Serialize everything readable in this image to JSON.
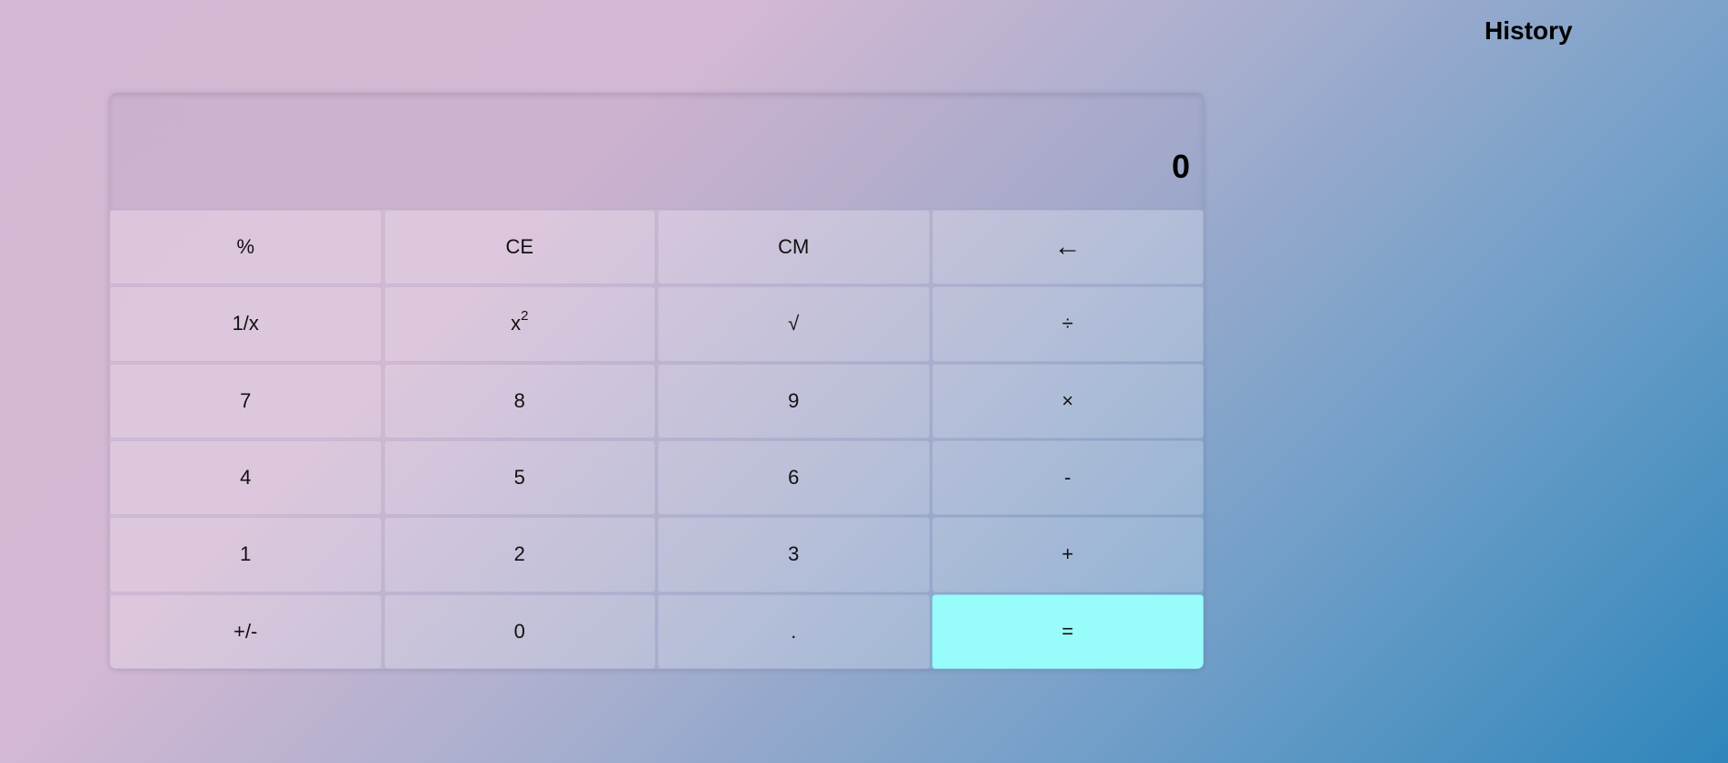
{
  "history": {
    "title": "History"
  },
  "display": {
    "value": "0"
  },
  "keys": {
    "percent": "%",
    "ce": "CE",
    "cm": "CM",
    "backspace": "←",
    "reciprocal": "1/x",
    "square_base": "x",
    "square_exp": "2",
    "sqrt": "√",
    "divide": "÷",
    "seven": "7",
    "eight": "8",
    "nine": "9",
    "multiply": "×",
    "four": "4",
    "five": "5",
    "six": "6",
    "subtract": "-",
    "one": "1",
    "two": "2",
    "three": "3",
    "add": "+",
    "negate": "+/-",
    "zero": "0",
    "decimal": ".",
    "equals": "="
  },
  "colors": {
    "equals_button": "#98fcfa",
    "gradient_start": "#d4b7d2",
    "gradient_end": "#2f86bb"
  }
}
